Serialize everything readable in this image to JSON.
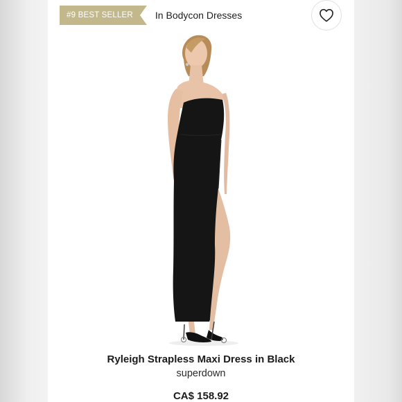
{
  "badge": {
    "label": "#9 BEST SELLER"
  },
  "category": {
    "label": "In Bodycon Dresses"
  },
  "favorite": {
    "icon": "heart-outline-icon"
  },
  "product": {
    "title": "Ryleigh Strapless Maxi Dress in Black",
    "brand": "superdown",
    "price": "CA$ 158.92"
  },
  "colors": {
    "badge": "#c3b88b",
    "text": "#1b1b1b",
    "background": "#ffffff"
  }
}
